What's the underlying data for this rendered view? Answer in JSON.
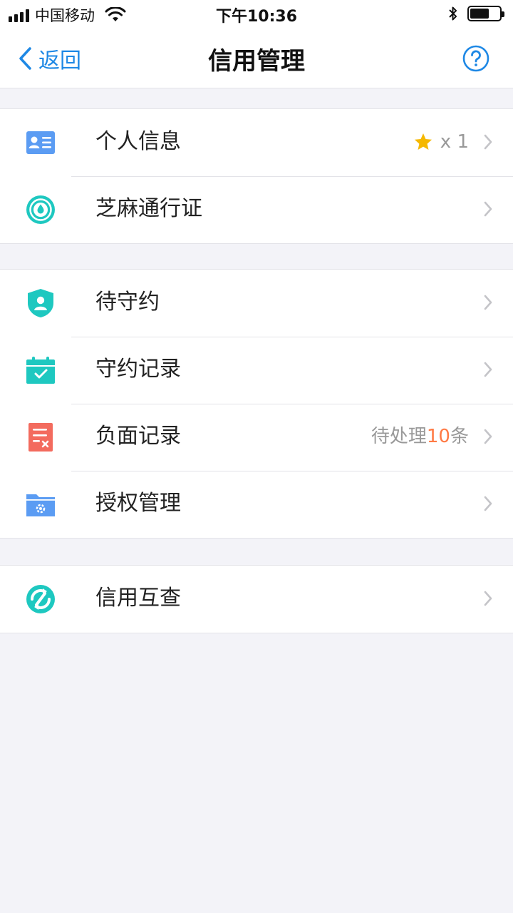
{
  "status_bar": {
    "carrier": "中国移动",
    "time": "下午10:36"
  },
  "nav": {
    "back_label": "返回",
    "title": "信用管理"
  },
  "groups": [
    {
      "items": [
        {
          "label": "个人信息",
          "icon": "id-card-icon",
          "badge_text": "x 1",
          "badge_icon": "star-icon"
        },
        {
          "label": "芝麻通行证",
          "icon": "sesame-pass-icon"
        }
      ]
    },
    {
      "items": [
        {
          "label": "待守约",
          "icon": "shield-user-icon"
        },
        {
          "label": "守约记录",
          "icon": "calendar-check-icon"
        },
        {
          "label": "负面记录",
          "icon": "negative-record-icon",
          "status_prefix": "待处理",
          "status_count": "10",
          "status_suffix": "条"
        },
        {
          "label": "授权管理",
          "icon": "folder-settings-icon"
        }
      ]
    },
    {
      "items": [
        {
          "label": "信用互查",
          "icon": "mutual-check-icon"
        }
      ]
    }
  ],
  "colors": {
    "accent": "#1e88e5",
    "teal": "#1ec8c0",
    "blue_icon": "#5b9cf3",
    "red_icon": "#f36b5e",
    "highlight": "#ff7a45",
    "star": "#f5b800"
  }
}
